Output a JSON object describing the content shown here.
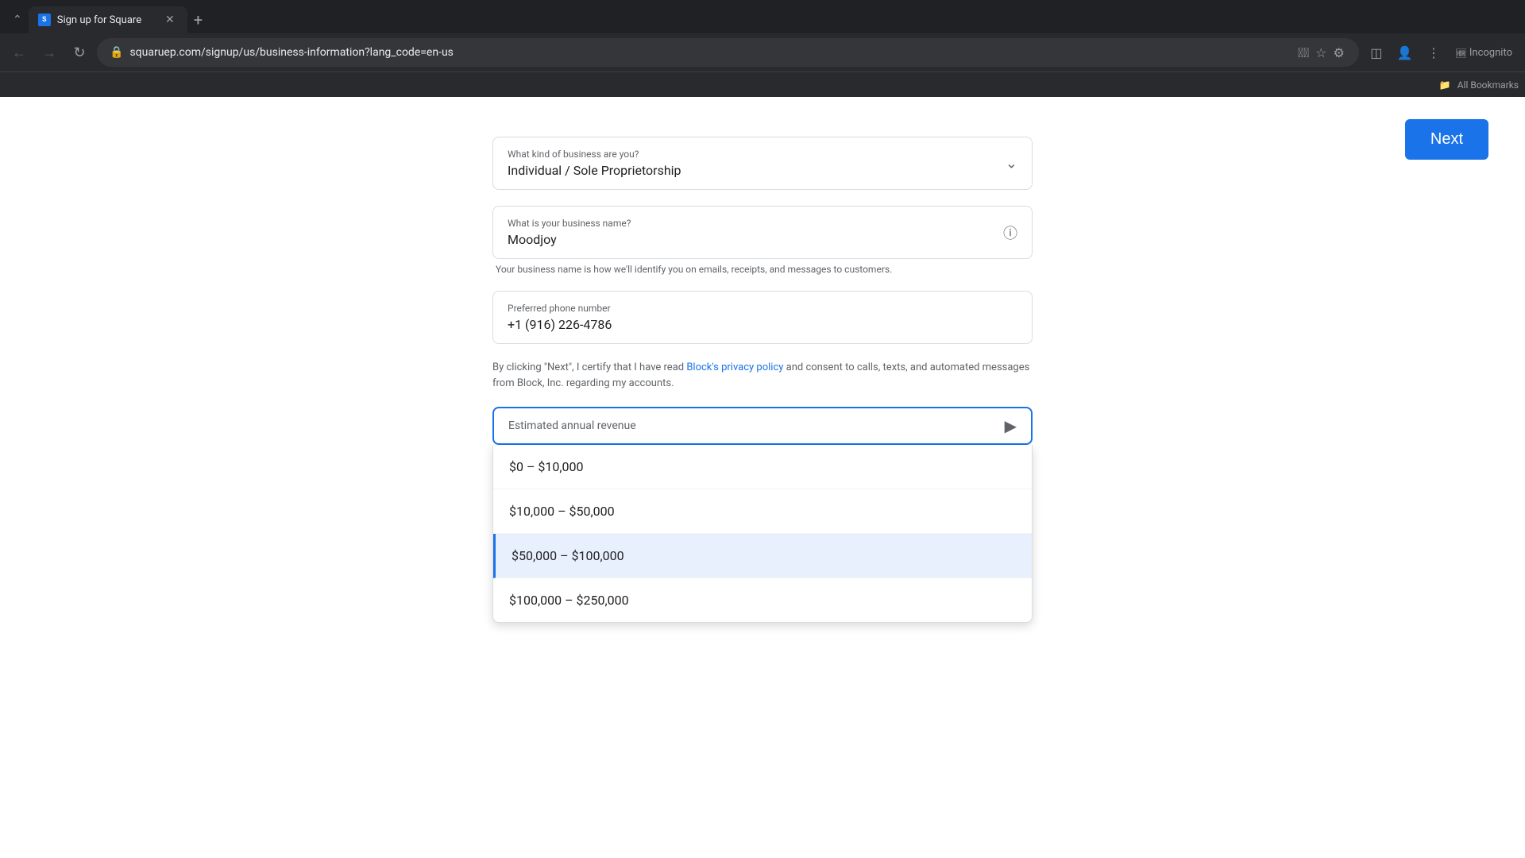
{
  "browser": {
    "tab_title": "Sign up for Square",
    "tab_favicon": "S",
    "url": "squaruep.com/signup/us/business-information?lang_code=en-us",
    "url_display": "squaruep.com/signup/us/business-information?lang_code=en-us",
    "incognito_label": "Incognito",
    "bookmarks_label": "All Bookmarks"
  },
  "page": {
    "next_button": "Next"
  },
  "form": {
    "business_type": {
      "label": "What kind of business are you?",
      "value": "Individual / Sole Proprietorship"
    },
    "business_name": {
      "label": "What is your business name?",
      "value": "Moodjoy",
      "helper": "Your business name is how we'll identify you on emails, receipts, and messages to customers."
    },
    "phone": {
      "label": "Preferred phone number",
      "value": "+1 (916) 226-4786"
    },
    "privacy_notice": {
      "text_before": "By clicking \"Next\", I certify that I have read ",
      "link_text": "Block's privacy policy",
      "text_after": " and consent to calls, texts, and automated messages from Block, Inc. regarding my accounts."
    },
    "revenue": {
      "label": "Estimated annual revenue"
    },
    "revenue_options": [
      {
        "label": "$0 – $10,000",
        "value": "0-10000"
      },
      {
        "label": "$10,000 – $50,000",
        "value": "10000-50000"
      },
      {
        "label": "$50,000 – $100,000",
        "value": "50000-100000"
      },
      {
        "label": "$100,000 – $250,000",
        "value": "100000-250000"
      }
    ]
  }
}
